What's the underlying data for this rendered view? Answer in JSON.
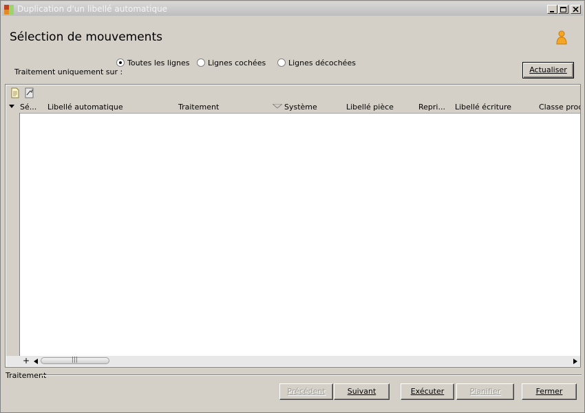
{
  "window": {
    "title": "Duplication d'un libellé automatique"
  },
  "page": {
    "title": "Sélection de mouvements"
  },
  "scope": {
    "label": "Traitement uniquement sur :",
    "options": [
      {
        "label": "Toutes les lignes",
        "selected": true
      },
      {
        "label": "Lignes cochées",
        "selected": false
      },
      {
        "label": "Lignes décochées",
        "selected": false
      }
    ]
  },
  "actions": {
    "refresh": "Actualiser"
  },
  "grid": {
    "toolbar": {
      "icons": [
        "new-document-icon",
        "export-icon"
      ]
    },
    "columns": [
      "Sé...",
      "Libellé automatique",
      "Traitement",
      "Système",
      "Libellé pièce",
      "Repri...",
      "Libellé écriture",
      "Classe proce"
    ],
    "sort_column": "Système",
    "rows": [],
    "add_row_symbol": "+",
    "scroll_thumb_grip": "|||"
  },
  "status": {
    "label": "Traitement"
  },
  "footer": {
    "previous": "Précédent",
    "next": "Suivant",
    "execute": "Exécuter",
    "schedule": "Planifier",
    "close": "Fermer"
  },
  "colors": {
    "background": "#d4d0c8",
    "title_text": "#f4f4f4",
    "user_icon": "#f5a623"
  }
}
